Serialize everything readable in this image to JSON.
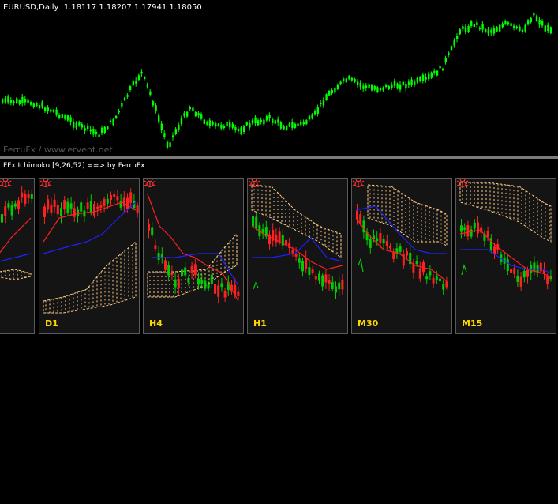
{
  "main_chart": {
    "title": "EURUSD,Daily  1.18117 1.18207 1.17941 1.18050",
    "watermark": "FerruFx / www.ervent.net",
    "candle_color": "#00ff00",
    "background": "#000000"
  },
  "indicator": {
    "title": "FFx Ichimoku [9,26,52] ==> by FerruFx",
    "panel_background": "#141414",
    "colors": {
      "bull_candle": "#00cc00",
      "bear_candle": "#ff2020",
      "tenkan": "#ff2020",
      "kijun": "#2020ff",
      "cloud": "#ffcc88",
      "label": "#ffd700",
      "bug_icon": "#ff3030"
    },
    "panels": [
      {
        "id": "panel-w1",
        "label": "",
        "icon": "bug-icon"
      },
      {
        "id": "panel-d1",
        "label": "D1",
        "icon": "bug-icon"
      },
      {
        "id": "panel-h4",
        "label": "H4",
        "icon": "bug-icon"
      },
      {
        "id": "panel-h1",
        "label": "H1",
        "icon": "bug-icon"
      },
      {
        "id": "panel-m30",
        "label": "M30",
        "icon": "bug-icon"
      },
      {
        "id": "panel-m15",
        "label": "M15",
        "icon": "bug-icon"
      }
    ]
  }
}
